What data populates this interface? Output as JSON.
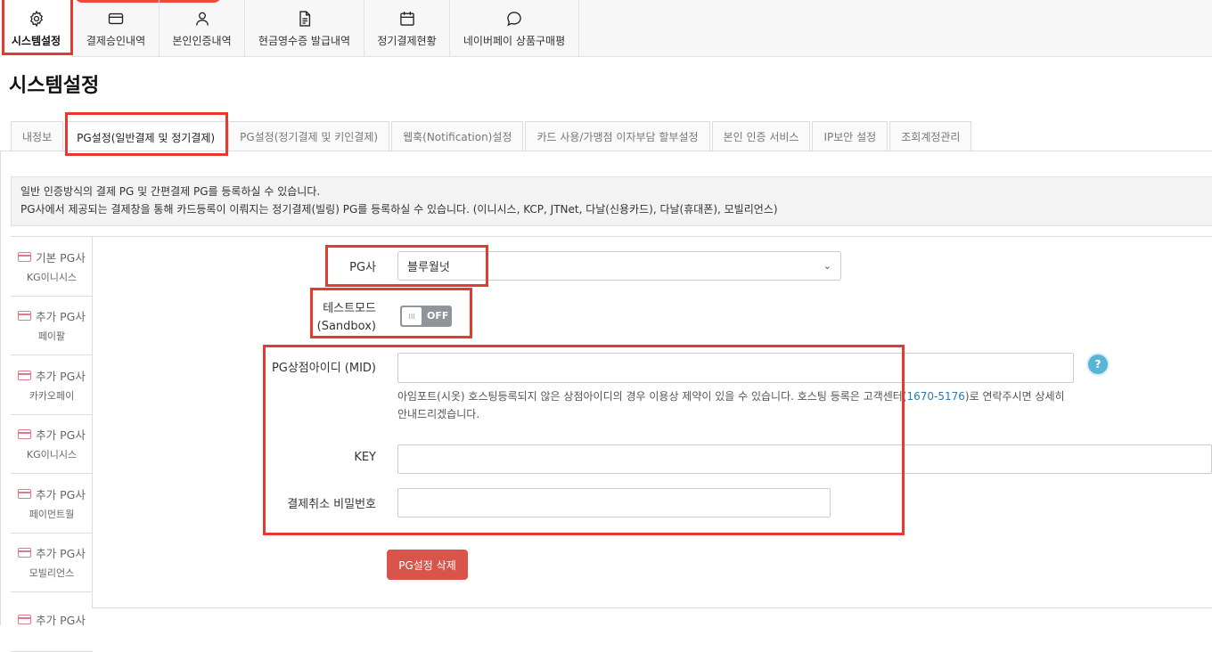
{
  "topnav": {
    "items": [
      {
        "label": "시스템설정",
        "icon": "gear-icon"
      },
      {
        "label": "결제승인내역",
        "icon": "credit-card-icon"
      },
      {
        "label": "본인인증내역",
        "icon": "user-icon"
      },
      {
        "label": "현금영수증 발급내역",
        "icon": "document-icon"
      },
      {
        "label": "정기결제현황",
        "icon": "calendar-icon"
      },
      {
        "label": "네이버페이 상품구매평",
        "icon": "chat-bubble-icon"
      }
    ]
  },
  "page": {
    "title": "시스템설정"
  },
  "tabs": [
    "내정보",
    "PG설정(일반결제 및 정기결제)",
    "PG설정(정기결제 및 키인결제)",
    "웹훅(Notification)설정",
    "카드 사용/가맹점 이자부담 할부설정",
    "본인 인증 서비스",
    "IP보안 설정",
    "조회계정관리"
  ],
  "info": {
    "line1": "일반 인증방식의 결제 PG 및 간편결제 PG를 등록하실 수 있습니다.",
    "line2": "PG사에서 제공되는 결제창을 통해 카드등록이 이뤄지는 정기결제(빌링) PG를 등록하실 수 있습니다. (이니시스, KCP, JTNet, 다날(신용카드), 다날(휴대폰), 모빌리언스)"
  },
  "pg_list": [
    {
      "title": "기본 PG사",
      "sub": "KG이니시스"
    },
    {
      "title": "추가 PG사",
      "sub": "페이팔"
    },
    {
      "title": "추가 PG사",
      "sub": "카카오페이"
    },
    {
      "title": "추가 PG사",
      "sub": "KG이니시스"
    },
    {
      "title": "추가 PG사",
      "sub": "페이먼트월"
    },
    {
      "title": "추가 PG사",
      "sub": "모빌리언스"
    },
    {
      "title": "추가 PG사",
      "sub": ""
    }
  ],
  "form": {
    "pg_label": "PG사",
    "pg_value": "블루월넛",
    "test_label_1": "테스트모드",
    "test_label_2": "(Sandbox)",
    "toggle_knob": "III",
    "toggle_text": "OFF",
    "mid_label": "PG상점아이디 (MID)",
    "mid_value": "",
    "help_icon": "?",
    "note_before": "아임포트(시옷) 호스팅등록되지 않은 상점아이디의 경우 이용상 제약이 있을 수 있습니다. 호스팅 등록은 고객센터(",
    "note_phone": "1670-5176",
    "note_after": ")로 연락주시면 상세히 안내드리겠습니다.",
    "key_label": "KEY",
    "key_value": "",
    "cancel_pw_label": "결제취소 비밀번호",
    "cancel_pw_value": "",
    "delete_button": "PG설정 삭제"
  },
  "colors": {
    "highlight": "#e8392e",
    "delete_button": "#d9544a",
    "link": "#2a7ab8",
    "card_icon": "#e07a8a"
  }
}
